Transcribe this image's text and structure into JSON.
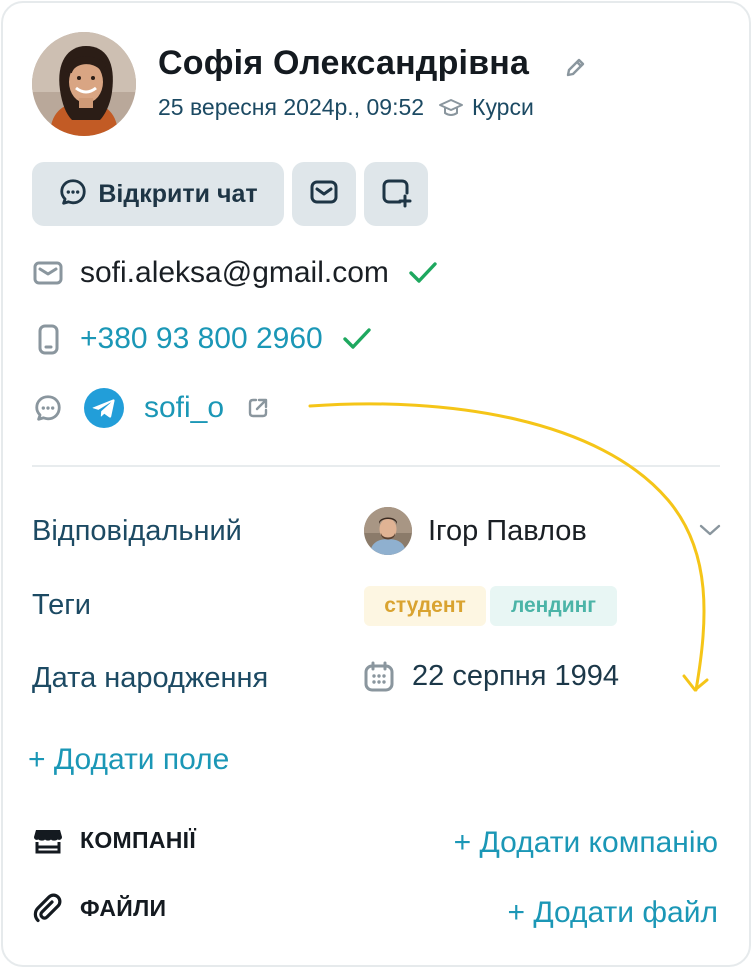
{
  "contact": {
    "name": "Софія Олександрівна",
    "created": "25 вересня 2024р., 09:52",
    "source": "Курси"
  },
  "actions": {
    "open_chat_label": "Відкрити чат"
  },
  "channels": {
    "email": "sofi.aleksa@gmail.com",
    "phone": "+380 93 800 2960",
    "telegram": "sofi_o"
  },
  "fields": {
    "responsible_label": "Відповідальний",
    "responsible_value": "Ігор Павлов",
    "tags_label": "Теги",
    "tags": [
      "студент",
      "лендинг"
    ],
    "birthday_label": "Дата народження",
    "birthday_value": "22 серпня 1994",
    "add_field": "+ Додати поле"
  },
  "sections": {
    "companies_title": "КОМПАНІЇ",
    "add_company": "+ Додати компанію",
    "files_title": "ФАЙЛИ",
    "add_file": "+ Додати файл"
  },
  "colors": {
    "accent": "#1b97b6",
    "verified": "#1ea85f",
    "button_bg": "#dfe6ea",
    "tag_student_bg": "#fdf6e2",
    "tag_student_fg": "#d9a330",
    "tag_landing_bg": "#e8f6f4",
    "tag_landing_fg": "#4bb4a7",
    "annotation_arrow": "#f5c518"
  },
  "icons": {
    "edit": "pencil-icon",
    "source": "graduation-cap-icon",
    "chat": "chat-bubble-icon",
    "mail": "envelope-icon",
    "add_window": "add-window-icon",
    "email_row": "envelope-icon",
    "phone_row": "phone-icon",
    "messenger_row": "chat-bubble-icon",
    "telegram": "telegram-logo",
    "verified": "check-icon",
    "external": "external-link-icon",
    "chevron": "chevron-down-icon",
    "calendar": "calendar-icon",
    "companies": "store-icon",
    "files": "paperclip-icon"
  }
}
